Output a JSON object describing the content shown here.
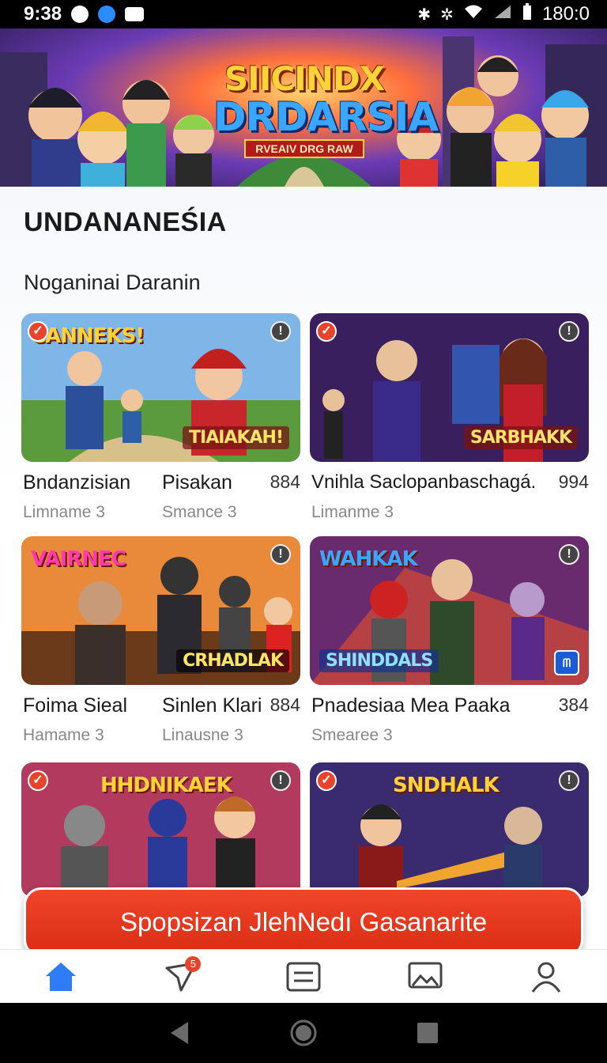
{
  "status_bar": {
    "time": "9:38",
    "battery": "180:0"
  },
  "hero": {
    "title_line1": "SIICINDX",
    "title_line2": "DRDARSIA",
    "tagline": "RVEAIV DRG RAW"
  },
  "page_heading": "UNDANANEŚIA",
  "section_title": "Noganinai Daranin",
  "cards": [
    {
      "thumb_title": "CANNEKS!",
      "thumb_badge": "TIAIAKAH!",
      "name1": "Bndanzisian",
      "name2": "Pisakan",
      "count": "884",
      "sub1": "Limname 3",
      "sub2": "Smance 3"
    },
    {
      "thumb_title": "",
      "thumb_badge": "SARBHAKK",
      "name1": "Vnihla Saclopanbaschagá.",
      "name2": "",
      "count": "994",
      "sub1": "Limanme 3",
      "sub2": ""
    },
    {
      "thumb_title": "VAIRNEC",
      "thumb_badge": "CRHADLAK",
      "name1": "Foima Sieal",
      "name2": "Sinlen Klari",
      "count": "884",
      "sub1": "Hamame 3",
      "sub2": "Linausne 3"
    },
    {
      "thumb_title": "WAHKAK",
      "thumb_badge": "SHINDDALS",
      "name1": "Pnadesiaa Mea Paaka",
      "name2": "",
      "count": "384",
      "sub1": "Smearee 3",
      "sub2": ""
    },
    {
      "thumb_title": "HHDNIKAEK",
      "thumb_badge": "",
      "name1": "",
      "name2": "",
      "count": "",
      "sub1": "",
      "sub2": ""
    },
    {
      "thumb_title": "SNDHALK",
      "thumb_badge": "",
      "name1": "",
      "name2": "",
      "count": "",
      "sub1": "",
      "sub2": ""
    }
  ],
  "cta_label": "Spopsizan JlehNedı Gasanarite",
  "bottom_nav": {
    "notification_count": "5"
  },
  "colors": {
    "accent": "#e8432b",
    "nav_active": "#2f7df6"
  }
}
